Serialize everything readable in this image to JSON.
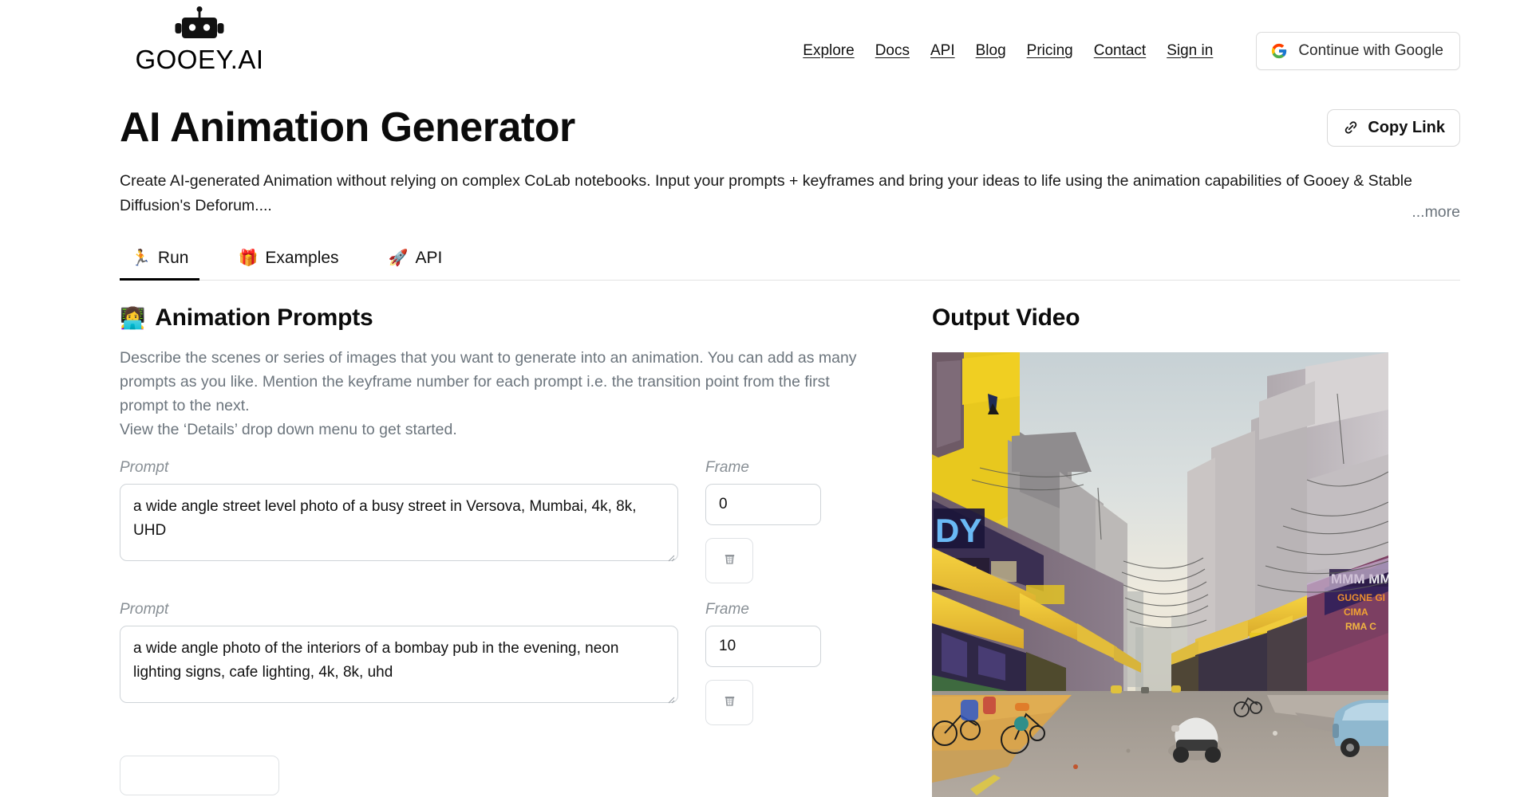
{
  "header": {
    "logo_text": "GOOEY.AI",
    "logo_icon": "robot-head-icon",
    "nav": [
      {
        "label": "Explore"
      },
      {
        "label": "Docs"
      },
      {
        "label": "API"
      },
      {
        "label": "Blog"
      },
      {
        "label": "Pricing"
      },
      {
        "label": "Contact"
      },
      {
        "label": "Sign in"
      }
    ],
    "google_button": {
      "label": "Continue with Google",
      "icon": "google-g-icon"
    }
  },
  "title_bar": {
    "title": "AI Animation Generator",
    "copy_link": {
      "label": "Copy Link",
      "icon": "link-chain-icon"
    }
  },
  "description": {
    "text": "Create AI-generated Animation without relying on complex CoLab notebooks. Input your prompts + keyframes and bring your ideas to life using the animation capabilities of Gooey & Stable Diffusion's Deforum....",
    "more_label": "...more"
  },
  "tabs": [
    {
      "label": "Run",
      "icon": "running-person-icon",
      "glyph": "🏃",
      "active": true
    },
    {
      "label": "Examples",
      "icon": "gift-icon",
      "glyph": "🎁",
      "active": false
    },
    {
      "label": "API",
      "icon": "rocket-icon",
      "glyph": "🚀",
      "active": false
    }
  ],
  "prompts_panel": {
    "heading": "Animation Prompts",
    "heading_emoji": "👩‍💻",
    "help_lines": [
      "Describe the scenes or series of images that you want to generate into an animation. You can add as many prompts as you like. Mention the keyframe number for each prompt i.e. the transition point from the first prompt to the next.",
      "View the ‘Details’ drop down menu to get started."
    ],
    "prompt_label": "Prompt",
    "frame_label": "Frame",
    "delete_icon": "trash-bin-icon",
    "delete_glyph": "🗑",
    "rows": [
      {
        "prompt_value": "a wide angle street level photo of a busy street in Versova, Mumbai, 4k, 8k, UHD",
        "frame_value": "0"
      },
      {
        "prompt_value": "a wide angle photo of the interiors of a bombay pub in the evening, neon lighting signs, cafe lighting, 4k, 8k, uhd",
        "frame_value": "10"
      }
    ]
  },
  "output_panel": {
    "title": "Output Video",
    "image_alt": "AI generated wide angle street level photo of a busy street in Versova Mumbai with yellow awnings and neon shop signs"
  },
  "colors": {
    "accent_black": "#000000",
    "muted_text": "#6c757d",
    "border": "#cfd4d8",
    "google_blue": "#4285F4",
    "google_red": "#EA4335",
    "google_yellow": "#FBBC05",
    "google_green": "#34A853"
  }
}
